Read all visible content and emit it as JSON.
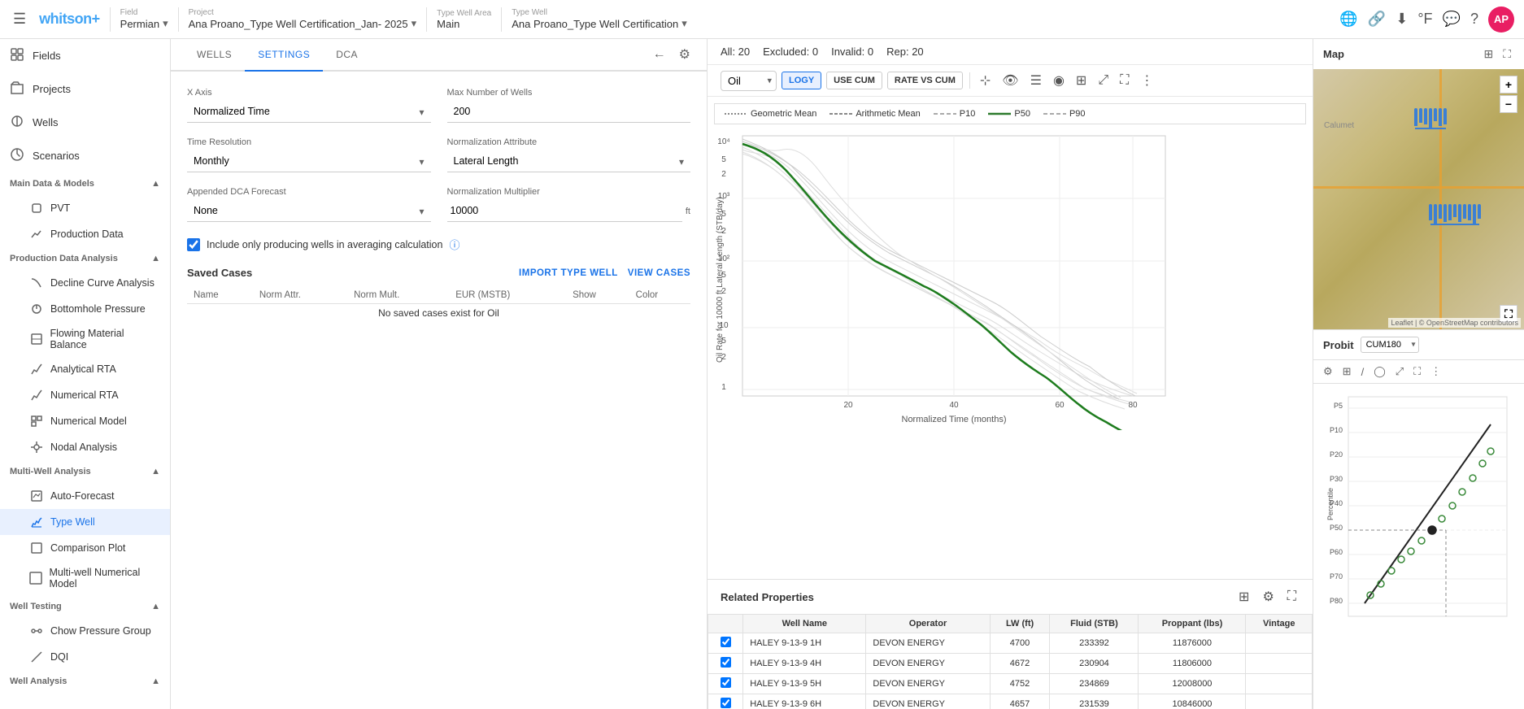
{
  "topbar": {
    "menu_icon": "☰",
    "logo": "whitson",
    "logo_plus": "+",
    "field_label": "Field",
    "field_value": "Permian",
    "project_label": "Project",
    "project_value": "Ana Proano_Type Well Certification_Jan- 2025",
    "type_well_area_label": "Type Well Area",
    "type_well_area_value": "Main",
    "type_well_label": "Type Well",
    "type_well_value": "Ana Proano_Type Well Certification",
    "icons": [
      "🌐",
      "🔗",
      "⬇",
      "°F",
      "💬",
      "?"
    ],
    "avatar": "AP"
  },
  "sidebar": {
    "top_items": [
      {
        "label": "Fields",
        "icon": "grid"
      },
      {
        "label": "Projects",
        "icon": "folder"
      },
      {
        "label": "Wells",
        "icon": "well"
      },
      {
        "label": "Scenarios",
        "icon": "branch"
      }
    ],
    "sections": [
      {
        "title": "Main Data & Models",
        "items": [
          {
            "label": "PVT",
            "icon": "pvt"
          },
          {
            "label": "Production Data",
            "icon": "chart"
          }
        ]
      },
      {
        "title": "Production Data Analysis",
        "items": [
          {
            "label": "Decline Curve Analysis",
            "icon": "decline"
          },
          {
            "label": "Bottomhole Pressure",
            "icon": "pressure"
          },
          {
            "label": "Flowing Material Balance",
            "icon": "balance"
          },
          {
            "label": "Analytical RTA",
            "icon": "rta"
          },
          {
            "label": "Numerical RTA",
            "icon": "num-rta"
          },
          {
            "label": "Numerical Model",
            "icon": "num-model"
          },
          {
            "label": "Nodal Analysis",
            "icon": "nodal"
          }
        ]
      },
      {
        "title": "Multi-Well Analysis",
        "items": [
          {
            "label": "Auto-Forecast",
            "icon": "auto"
          },
          {
            "label": "Type Well",
            "icon": "type-well",
            "active": true
          },
          {
            "label": "Comparison Plot",
            "icon": "compare"
          },
          {
            "label": "Multi-well Numerical Model",
            "icon": "multi-num"
          }
        ]
      },
      {
        "title": "Well Testing",
        "items": [
          {
            "label": "Chow Pressure Group",
            "icon": "chow"
          },
          {
            "label": "DQI",
            "icon": "dqi"
          }
        ]
      },
      {
        "title": "Well Analysis",
        "items": []
      }
    ]
  },
  "tabs": {
    "items": [
      "WELLS",
      "SETTINGS",
      "DCA"
    ],
    "active": "SETTINGS"
  },
  "settings": {
    "x_axis_label": "X Axis",
    "x_axis_value": "Normalized Time",
    "max_wells_label": "Max Number of Wells",
    "max_wells_value": "200",
    "time_resolution_label": "Time Resolution",
    "time_resolution_value": "Monthly",
    "norm_attribute_label": "Normalization Attribute",
    "norm_attribute_value": "Lateral Length",
    "appended_dca_label": "Appended DCA Forecast",
    "appended_dca_value": "None",
    "norm_multiplier_label": "Normalization Multiplier",
    "norm_multiplier_value": "10000",
    "norm_multiplier_unit": "ft",
    "checkbox_label": "Include only producing wells in averaging calculation",
    "checkbox_checked": true
  },
  "saved_cases": {
    "title": "Saved Cases",
    "actions": [
      "IMPORT TYPE WELL",
      "VIEW CASES"
    ],
    "columns": [
      "Name",
      "Norm Attr.",
      "Norm Mult.",
      "EUR (MSTB)",
      "Show",
      "Color"
    ],
    "no_data": "No saved cases exist for Oil"
  },
  "chart": {
    "stats": {
      "all": "All: 20",
      "excluded": "Excluded: 0",
      "invalid": "Invalid: 0",
      "rep": "Rep: 20"
    },
    "fluid": "Oil",
    "buttons": [
      {
        "label": "LOGY",
        "active": true
      },
      {
        "label": "USE CUM",
        "active": false
      },
      {
        "label": "RATE VS CUM",
        "active": false
      }
    ],
    "legend": [
      {
        "label": "Geometric Mean",
        "style": "dotted",
        "color": "#888"
      },
      {
        "label": "Arithmetic Mean",
        "style": "dashed",
        "color": "#888"
      },
      {
        "label": "P10",
        "style": "dashed",
        "color": "#aaa"
      },
      {
        "label": "P50",
        "style": "solid",
        "color": "#2d7a2d"
      },
      {
        "label": "P90",
        "style": "dashed",
        "color": "#aaa"
      }
    ],
    "y_axis_label": "Oil Rate for 10000 ft Lateral Length (STB/day)",
    "x_axis_label": "Normalized Time (months)",
    "x_ticks": [
      20,
      40,
      60,
      80
    ],
    "y_ticks": [
      "10⁴",
      "5",
      "2",
      "10³",
      "5",
      "2",
      "10²",
      "5",
      "2",
      "10",
      "5",
      "2",
      "1"
    ]
  },
  "related_properties": {
    "title": "Related Properties",
    "columns": [
      "",
      "Well Name",
      "Operator",
      "LW (ft)",
      "Fluid (STB)",
      "Proppant (lbs)",
      "Vintage"
    ],
    "rows": [
      {
        "checked": true,
        "well": "HALEY 9-13-9 1H",
        "operator": "DEVON ENERGY",
        "lw": "4700",
        "fluid": "233392",
        "proppant": "11876000",
        "vintage": ""
      },
      {
        "checked": true,
        "well": "HALEY 9-13-9 4H",
        "operator": "DEVON ENERGY",
        "lw": "4672",
        "fluid": "230904",
        "proppant": "11806000",
        "vintage": ""
      },
      {
        "checked": true,
        "well": "HALEY 9-13-9 5H",
        "operator": "DEVON ENERGY",
        "lw": "4752",
        "fluid": "234869",
        "proppant": "12008000",
        "vintage": ""
      },
      {
        "checked": true,
        "well": "HALEY 9-13-9 6H",
        "operator": "DEVON ENERGY",
        "lw": "4657",
        "fluid": "231539",
        "proppant": "10846000",
        "vintage": ""
      }
    ]
  },
  "map": {
    "title": "Map",
    "probit_title": "Probit",
    "probit_select": "CUM180",
    "probit_labels": [
      "P5",
      "P10",
      "P20",
      "P30",
      "P40",
      "P50",
      "P60",
      "P70",
      "P80"
    ],
    "percentile_label": "Percentile"
  }
}
